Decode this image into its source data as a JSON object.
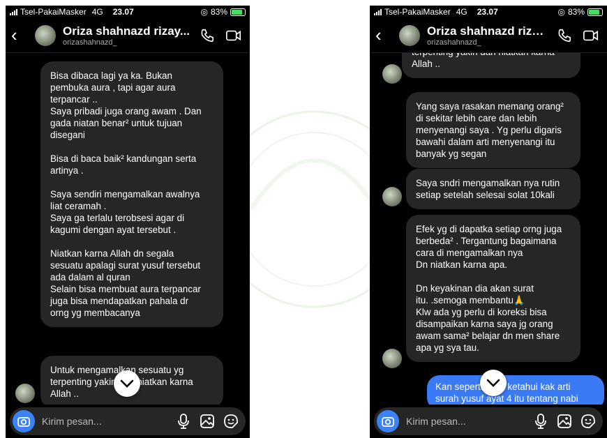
{
  "status": {
    "carrier": "Tsel-PakaiMasker",
    "network": "4G",
    "time": "23.07",
    "battery": "83%",
    "battery_level": 0.83
  },
  "chat": {
    "contact_name": "Oriza shahnazd rizay...",
    "username": "orizashahnazd_"
  },
  "composer": {
    "placeholder": "Kirim pesan..."
  },
  "left_messages": [
    "Bisa dibaca lagi ya ka.  Bukan\npembuka aura , tapi agar aura\nterpancar ..\nSaya pribadi juga orang awam . Dan\ngada niatan benar² untuk tujuan\ndisegani\n\nBisa di baca baik² kandungan serta\nartinya .\n\nSaya sendiri mengamalkan awalnya\nliat ceramah .\nSaya ga terlalu terobsesi agar di\nkagumi dengan ayat tersebut .\n\nNiatkan karna Allah dn segala\nsesuatu apalagi surat yusuf tersebut\nada dalam al quran\nSelain bisa membuat aura terpancar\njuga bisa mendapatkan pahala dr\norng yg membacanya",
    "Untuk mengamalkan sesuatu yg\nterpenting yakin dan niatkan karna\nAllah .."
  ],
  "right_messages": [
    "terpenting yakin dan niatkan karna\nAllah ..",
    "Yang saya rasakan memang orang²\ndi sekitar lebih care dan lebih\nmenyenangi saya . Yg perlu digaris\nbawahi dalam arti menyenangi itu\nbanyak yg segan",
    "Saya sndri mengamalkan nya rutin\nsetiap setelah selesai solat 10kali",
    "Efek yg di dapatka setiap orng juga\nberbeda² . Tergantung bagaimana\ncara di mengamalkan nya\nDn niatkan karna apa.\n\nDn keyakinan dia akan surat\nitu. .semoga membantu🙏\nKlw ada yg perlu di koreksi bisa\ndisampaikan karna saya jg orang\nawam sama² belajar dn men share\napa yg sya tau.",
    "Kan seperti yg kt ketahui kak arti\nsurah yusuf ayat 4 itu tentang nabi"
  ],
  "colors": {
    "incoming_bubble": "#262626",
    "outgoing_bubble": "#3a7bf5",
    "accent": "#3b82f6"
  }
}
